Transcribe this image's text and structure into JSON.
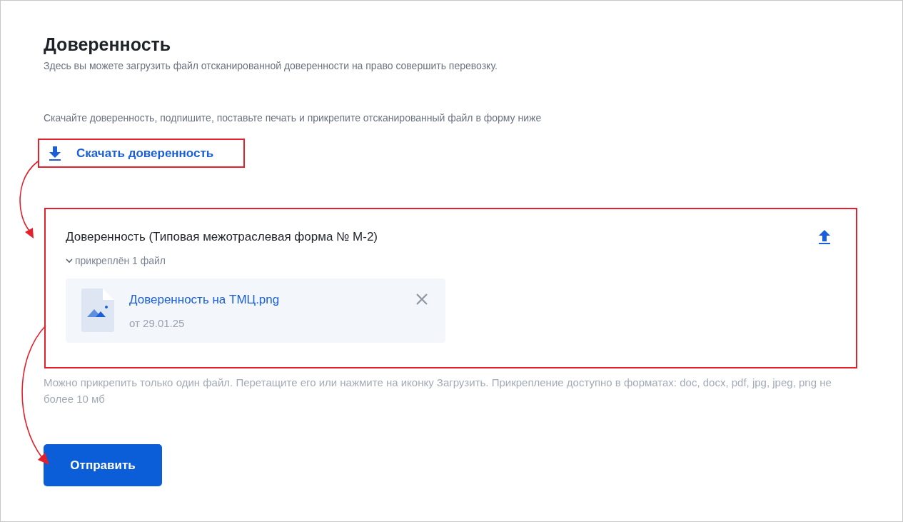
{
  "title": "Доверенность",
  "subtitle": "Здесь вы можете загрузить файл отсканированной доверенности на право совершить перевозку.",
  "instruction": "Скачайте доверенность, подпишите, поставьте печать и прикрепите отсканированный файл в форму ниже",
  "download_link": "Скачать доверенность",
  "upload": {
    "label": "Доверенность (Типовая межотраслевая форма № М-2)",
    "attached": "прикреплён 1 файл",
    "expanded": true,
    "files": [
      {
        "name": "Доверенность на ТМЦ.png",
        "date": "от 29.01.25"
      }
    ]
  },
  "hint": "Можно прикрепить только один файл. Перетащите его или нажмите на иконку Загрузить. Прикрепление доступно в форматах: doc, docx, pdf, jpg, jpeg, png не более 10 мб",
  "submit": "Отправить"
}
